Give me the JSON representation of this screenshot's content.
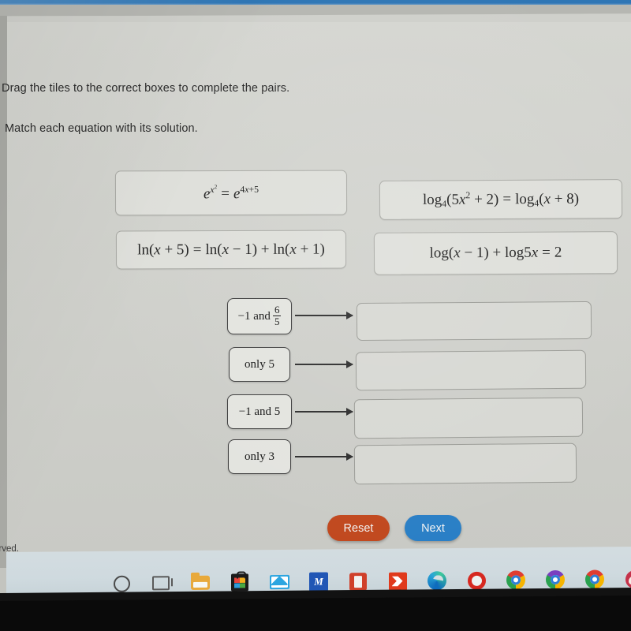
{
  "instructions": {
    "line1": "Drag the tiles to the correct boxes to complete the pairs.",
    "line2": "Match each equation with its solution."
  },
  "equations": [
    {
      "id": "eq-1",
      "text": "e^(x^2) = e^(4x+5)"
    },
    {
      "id": "eq-2",
      "text": "log_4(5x^2 + 2) = log_4(x + 8)"
    },
    {
      "id": "eq-3",
      "text": "ln(x + 5) = ln(x - 1) + ln(x + 1)"
    },
    {
      "id": "eq-4",
      "text": "log(x - 1) + log5x = 2"
    }
  ],
  "equation_parts": {
    "eq1": {
      "base": "e",
      "exp_left": "x",
      "exp_left_sup": "2",
      "equals": "=",
      "base2": "e",
      "exp_right": "4x+5"
    },
    "eq2": {
      "log": "log",
      "sub": "4",
      "left_arg_a": "(5x",
      "left_sup": "2",
      "left_arg_b": " + 2)",
      "equals": "=",
      "right_arg": "(x + 8)"
    },
    "eq3": {
      "ln1": "ln(x + 5)",
      "equals": "=",
      "ln2": "ln(x − 1)",
      "plus": "+",
      "ln3": "ln(x + 1)"
    },
    "eq4": {
      "log1": "log(x − 1)",
      "plus": "+",
      "log2": "log5x",
      "equals": "=",
      "result": "2"
    }
  },
  "answer_tiles": [
    {
      "id": "ans-1",
      "prefix": "−1 and",
      "fraction": {
        "numerator": "6",
        "denominator": "5"
      },
      "text": "-1 and 6/5"
    },
    {
      "id": "ans-2",
      "text": "only 5"
    },
    {
      "id": "ans-3",
      "text": "−1 and 5"
    },
    {
      "id": "ans-4",
      "text": "only 3"
    }
  ],
  "drop_boxes": [
    {
      "id": "drop-1",
      "value": ""
    },
    {
      "id": "drop-2",
      "value": ""
    },
    {
      "id": "drop-3",
      "value": ""
    },
    {
      "id": "drop-4",
      "value": ""
    }
  ],
  "buttons": {
    "reset": {
      "label": "Reset",
      "color": "#c1491f"
    },
    "next": {
      "label": "Next",
      "color": "#2a7fc6"
    }
  },
  "footer": {
    "partial_text": "erved."
  },
  "taskbar": {
    "icons": [
      {
        "name": "cortana-search-icon",
        "label": "Cortana"
      },
      {
        "name": "task-view-icon",
        "label": "Task View"
      },
      {
        "name": "file-explorer-icon",
        "label": "File Explorer"
      },
      {
        "name": "microsoft-store-icon",
        "label": "Microsoft Store"
      },
      {
        "name": "mail-icon",
        "label": "Mail"
      },
      {
        "name": "blue-app-icon",
        "label": "M"
      },
      {
        "name": "microsoft-office-icon",
        "label": "Office"
      },
      {
        "name": "red-app-icon",
        "label": "Red App"
      },
      {
        "name": "microsoft-edge-icon",
        "label": "Edge"
      },
      {
        "name": "opera-browser-icon",
        "label": "Opera"
      },
      {
        "name": "chrome-beta-icon",
        "label": "Chrome Beta"
      },
      {
        "name": "chrome-canary-icon",
        "label": "Chrome Canary"
      },
      {
        "name": "google-chrome-icon",
        "label": "Google Chrome"
      },
      {
        "name": "user-avatar-icon",
        "label": "Profile"
      }
    ]
  }
}
